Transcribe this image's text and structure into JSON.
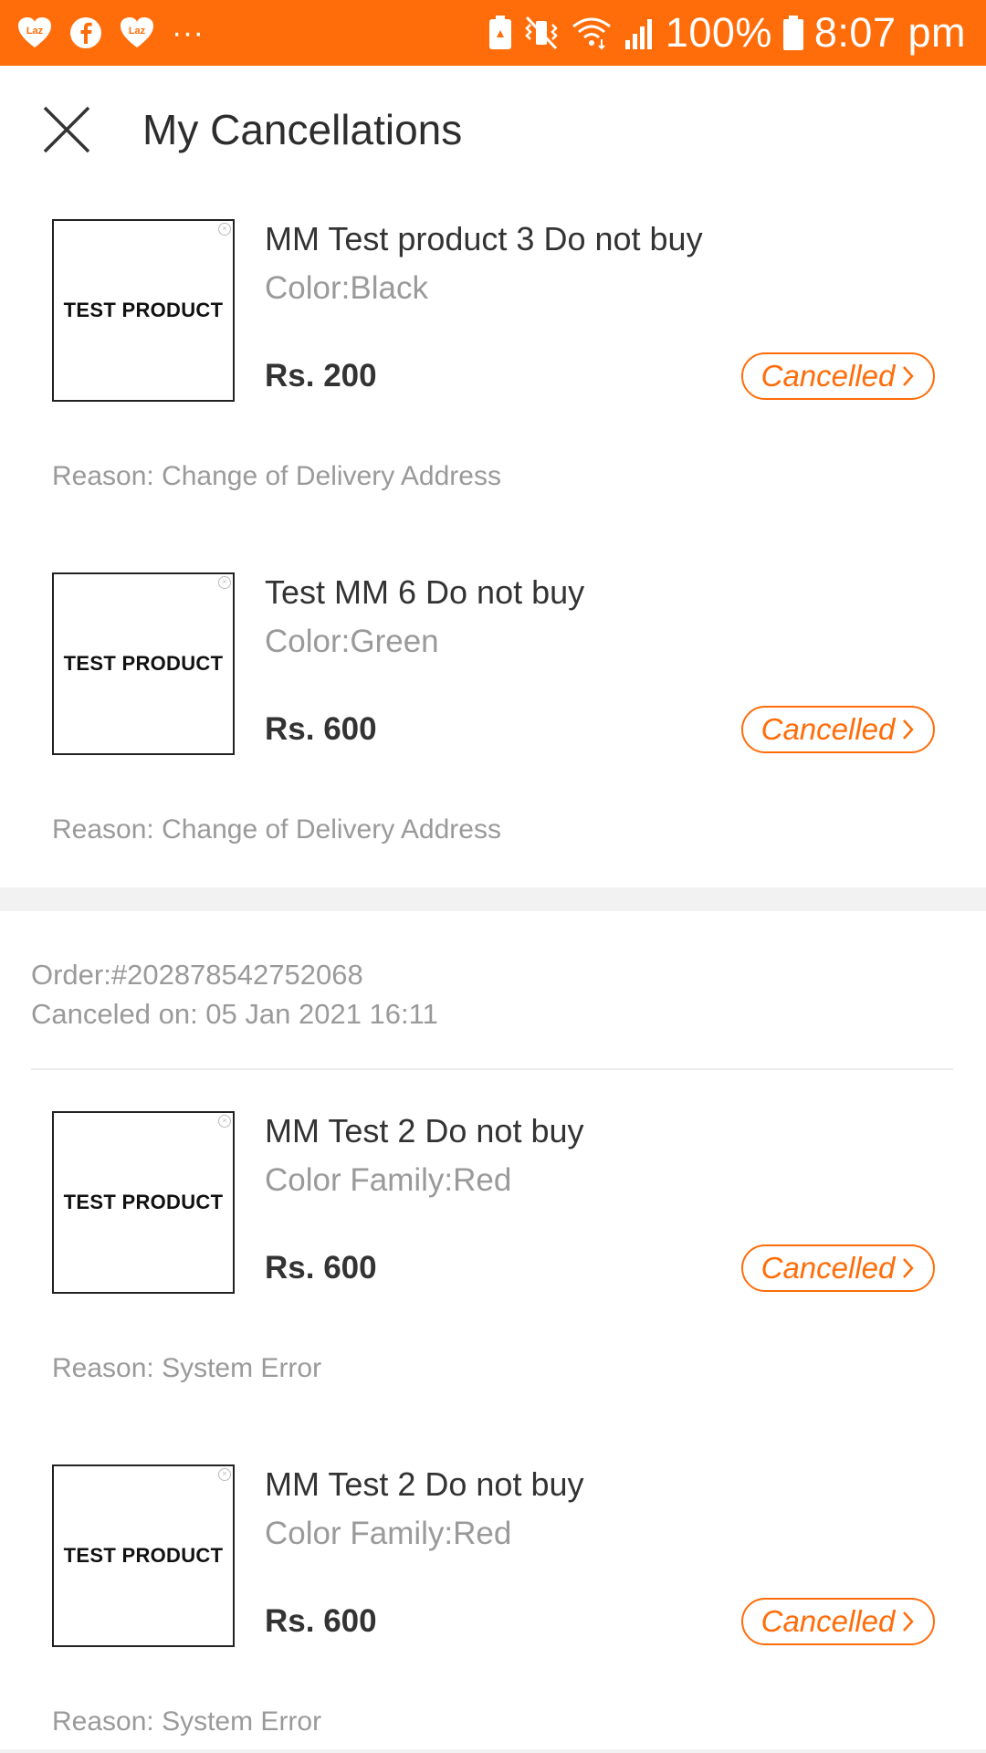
{
  "status_bar": {
    "battery_percent": "100%",
    "time": "8:07 pm",
    "overflow": "···",
    "app_icons": [
      "lazada-icon",
      "facebook-icon",
      "lazada-icon"
    ],
    "accent": "#ff6d0a"
  },
  "header": {
    "title": "My Cancellations"
  },
  "groups": [
    {
      "items": [
        {
          "thumbnail_text": "TEST PRODUCT",
          "name": "MM Test product 3 Do not buy",
          "variant": "Color:Black",
          "price": "Rs. 200",
          "status": "Cancelled",
          "reason": "Reason: Change of Delivery Address"
        },
        {
          "thumbnail_text": "TEST PRODUCT",
          "name": "Test MM 6 Do not buy",
          "variant": "Color:Green",
          "price": "Rs. 600",
          "status": "Cancelled",
          "reason": "Reason: Change of Delivery Address"
        }
      ]
    },
    {
      "order_id": "Order:#202878542752068",
      "canceled_on": "Canceled on: 05 Jan 2021 16:11",
      "items": [
        {
          "thumbnail_text": "TEST PRODUCT",
          "name": "MM Test 2 Do not buy",
          "variant": "Color Family:Red",
          "price": "Rs. 600",
          "status": "Cancelled",
          "reason": "Reason: System Error"
        },
        {
          "thumbnail_text": "TEST PRODUCT",
          "name": "MM Test 2 Do not buy",
          "variant": "Color Family:Red",
          "price": "Rs. 600",
          "status": "Cancelled",
          "reason": "Reason: System Error"
        }
      ]
    }
  ]
}
